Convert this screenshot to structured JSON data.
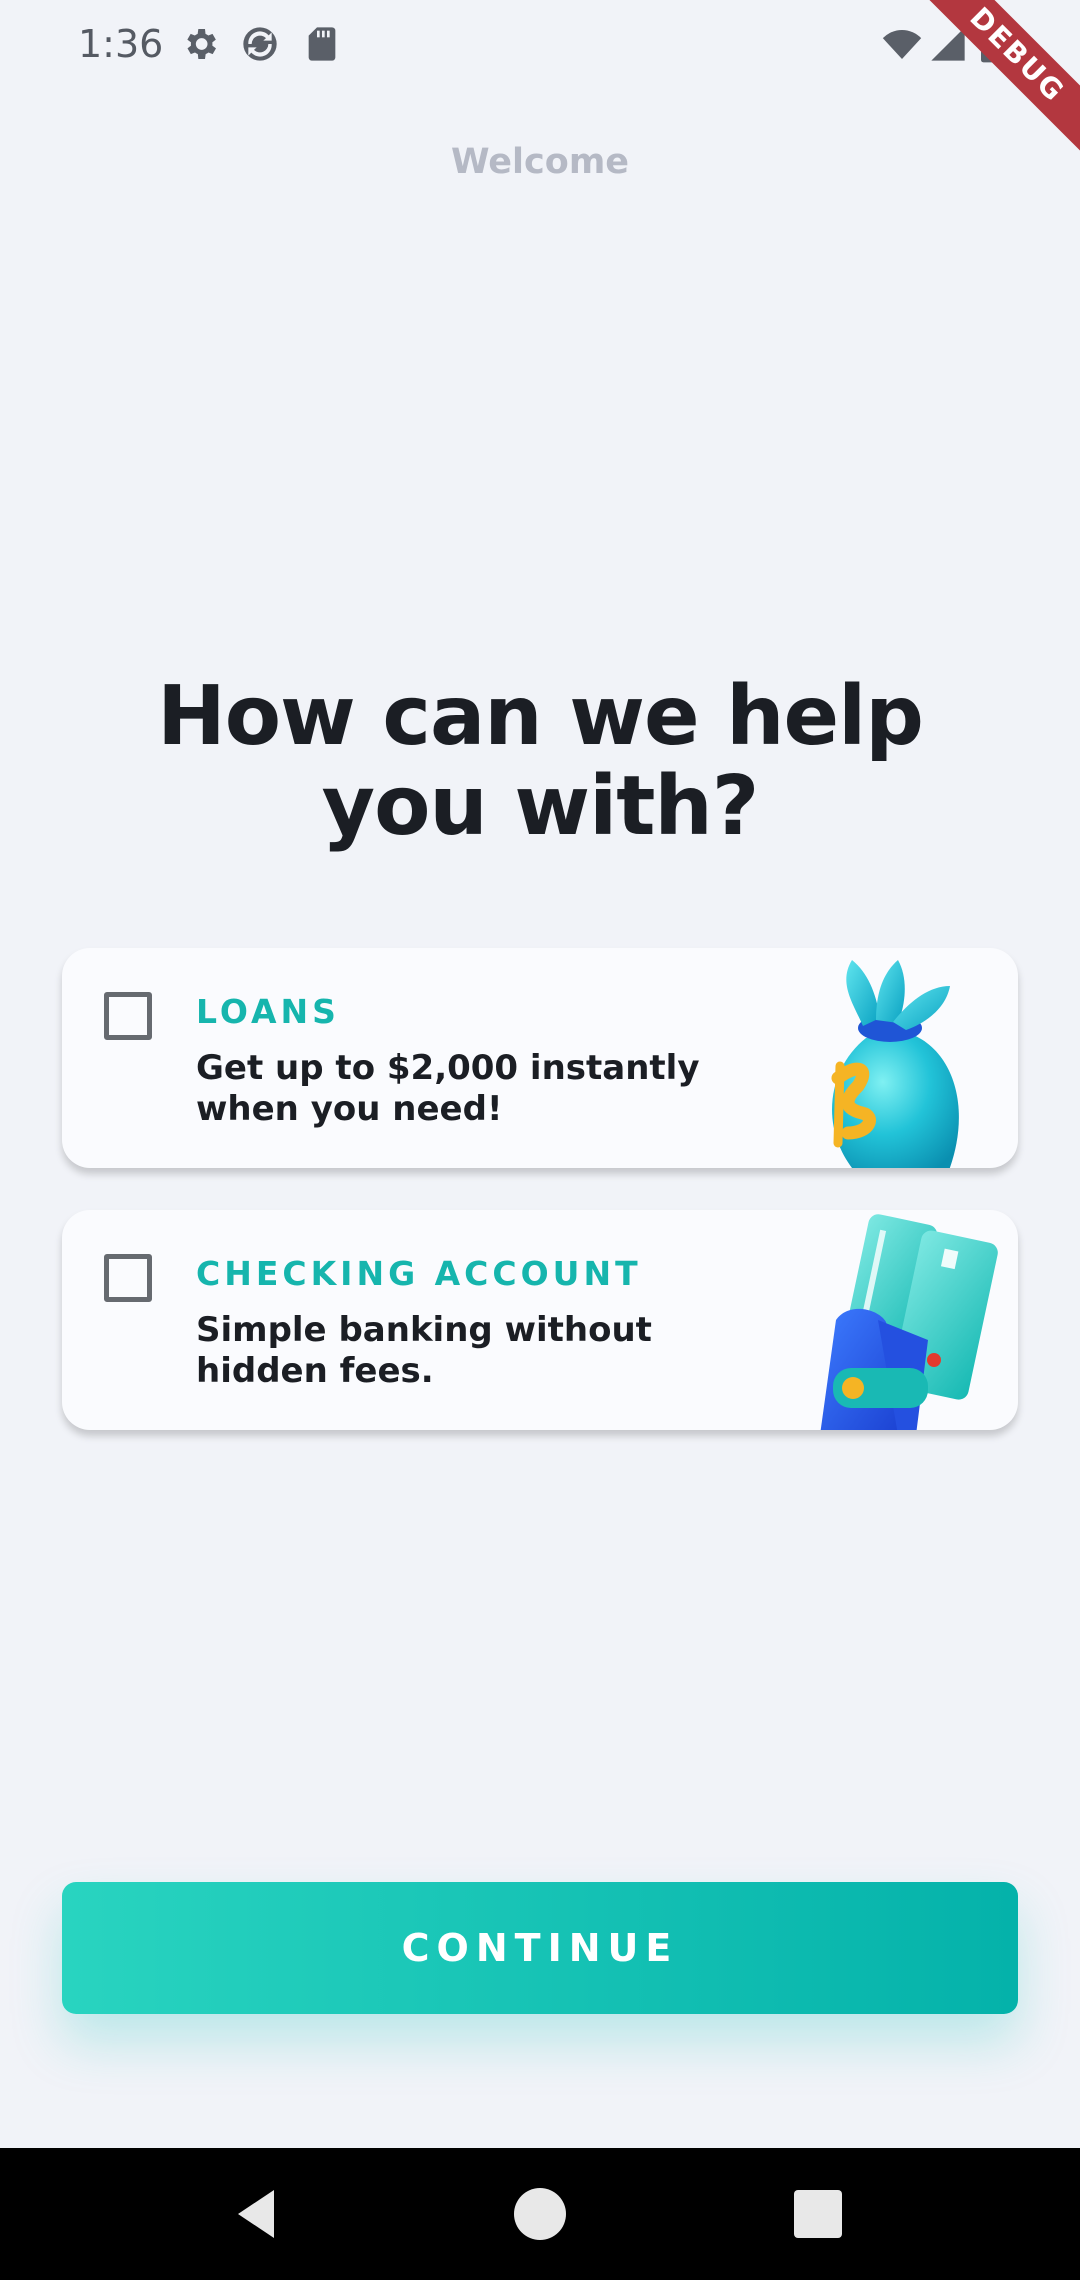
{
  "status_bar": {
    "time": "1:36",
    "left_icons": [
      "gear-icon",
      "sync-icon",
      "sd-card-icon"
    ],
    "right_icons": [
      "wifi-icon",
      "signal-icon",
      "battery-icon"
    ],
    "debug_banner": "DEBUG"
  },
  "header": {
    "title": "Welcome"
  },
  "main": {
    "headline": "How can we help you with?",
    "options": [
      {
        "label": "LOANS",
        "description": "Get up to $2,000 instantly when you need!",
        "checked": false,
        "illustration": "money-bag-icon"
      },
      {
        "label": "CHECKING ACCOUNT",
        "description": "Simple banking without hidden fees.",
        "checked": false,
        "illustration": "wallet-cards-icon"
      }
    ],
    "continue_label": "CONTINUE"
  },
  "nav_bar": {
    "buttons": [
      "back-icon",
      "home-icon",
      "recents-icon"
    ]
  },
  "colors": {
    "accent": "#16b5ad",
    "button_start": "#29d4c0",
    "button_end": "#04b2aa",
    "background": "#f1f3f8",
    "headline": "#1b1e24"
  }
}
